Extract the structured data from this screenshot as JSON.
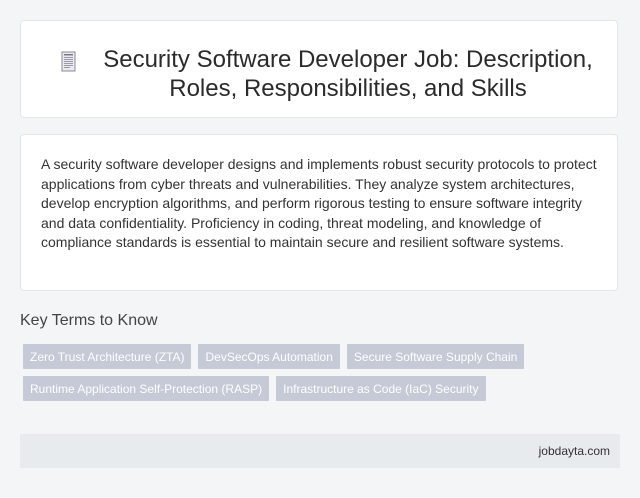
{
  "header": {
    "icon": "document-icon",
    "title": "Security Software Developer Job: Description, Roles, Responsibilities, and Skills"
  },
  "summary": {
    "text": "A security software developer designs and implements robust security protocols to protect applications from cyber threats and vulnerabilities. They analyze system architectures, develop encryption algorithms, and perform rigorous testing to ensure software integrity and data confidentiality. Proficiency in coding, threat modeling, and knowledge of compliance standards is essential to maintain secure and resilient software systems."
  },
  "key_terms": {
    "heading": "Key Terms to Know",
    "tags": [
      "Zero Trust Architecture (ZTA)",
      "DevSecOps Automation",
      "Secure Software Supply Chain",
      "Runtime Application Self-Protection (RASP)",
      "Infrastructure as Code (IaC) Security"
    ]
  },
  "footer": {
    "brand": "jobdayta.com"
  },
  "colors": {
    "background": "#f4f5f7",
    "card": "#ffffff",
    "tag": "#c6c9d6",
    "footer": "#e8ebee"
  }
}
